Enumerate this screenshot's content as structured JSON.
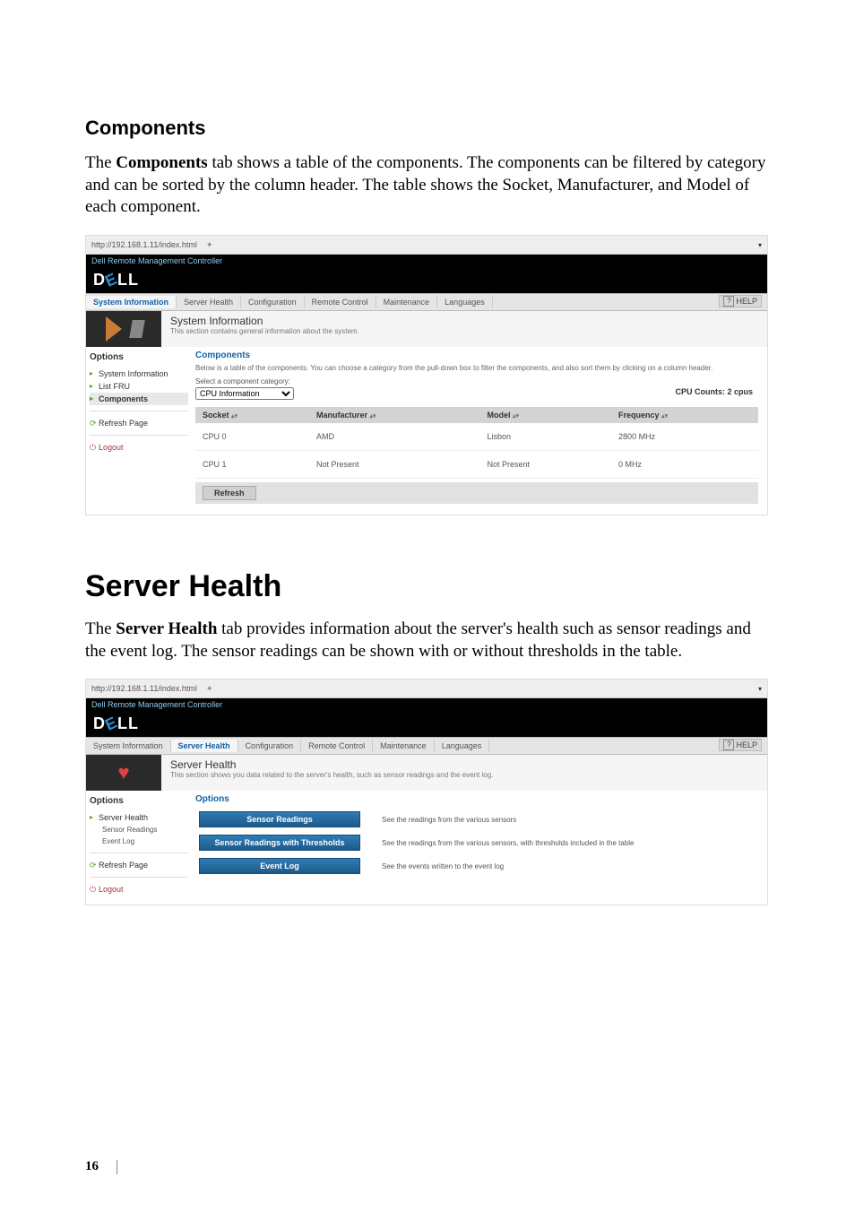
{
  "doc": {
    "h2_components": "Components",
    "p_components": "The Components tab shows a table of the components. The components can be filtered by category and can be sorted by the column header. The table shows the Socket, Manufacturer, and Model of each component.",
    "h1_server_health": "Server Health",
    "p_server_health": "The Server Health tab provides information about the server's health such as sensor readings and the event log. The sensor readings can be shown with or without thresholds in the table.",
    "page_number": "16"
  },
  "shot1": {
    "url": "http://192.168.1.11/index.html",
    "title": "Dell Remote Management Controller",
    "tabs": {
      "t0": "System Information",
      "t1": "Server Health",
      "t2": "Configuration",
      "t3": "Remote Control",
      "t4": "Maintenance",
      "t5": "Languages"
    },
    "help": "HELP",
    "header": {
      "title": "System Information",
      "sub": "This section contains general information about the system."
    },
    "sidebar": {
      "options": "Options",
      "i0": "System Information",
      "i1": "List FRU",
      "i2": "Components",
      "refresh": "Refresh Page",
      "logout": "Logout"
    },
    "panel": {
      "crumb": "Components",
      "desc": "Below is a table of the components. You can choose a category from the pull-down box to filter the components, and also sort them by clicking on a column header.",
      "select_label": "Select a component category:",
      "select_value": "CPU Information",
      "counts": "CPU Counts: 2 cpus",
      "cols": {
        "c0": "Socket",
        "c1": "Manufacturer",
        "c2": "Model",
        "c3": "Frequency"
      },
      "rows": [
        {
          "c0": "CPU 0",
          "c1": "AMD",
          "c2": "Lisbon",
          "c3": "2800 MHz"
        },
        {
          "c0": "CPU 1",
          "c1": "Not Present",
          "c2": "Not Present",
          "c3": "0 MHz"
        }
      ],
      "refresh_btn": "Refresh"
    }
  },
  "shot2": {
    "url": "http://192.168.1.11/index.html",
    "title": "Dell Remote Management Controller",
    "tabs": {
      "t0": "System Information",
      "t1": "Server Health",
      "t2": "Configuration",
      "t3": "Remote Control",
      "t4": "Maintenance",
      "t5": "Languages"
    },
    "help": "HELP",
    "header": {
      "title": "Server Health",
      "sub": "This section shows you data related to the server's health, such as sensor readings and the event log."
    },
    "sidebar": {
      "options": "Options",
      "i0": "Server Health",
      "i0a": "Sensor Readings",
      "i1": "Event Log",
      "refresh": "Refresh Page",
      "logout": "Logout"
    },
    "panel": {
      "crumb": "Options",
      "cards": [
        {
          "btn": "Sensor Readings",
          "desc": "See the readings from the various sensors"
        },
        {
          "btn": "Sensor Readings with Thresholds",
          "desc": "See the readings from the various sensors, with thresholds included in the table"
        },
        {
          "btn": "Event Log",
          "desc": "See the events written to the event log"
        }
      ]
    }
  }
}
